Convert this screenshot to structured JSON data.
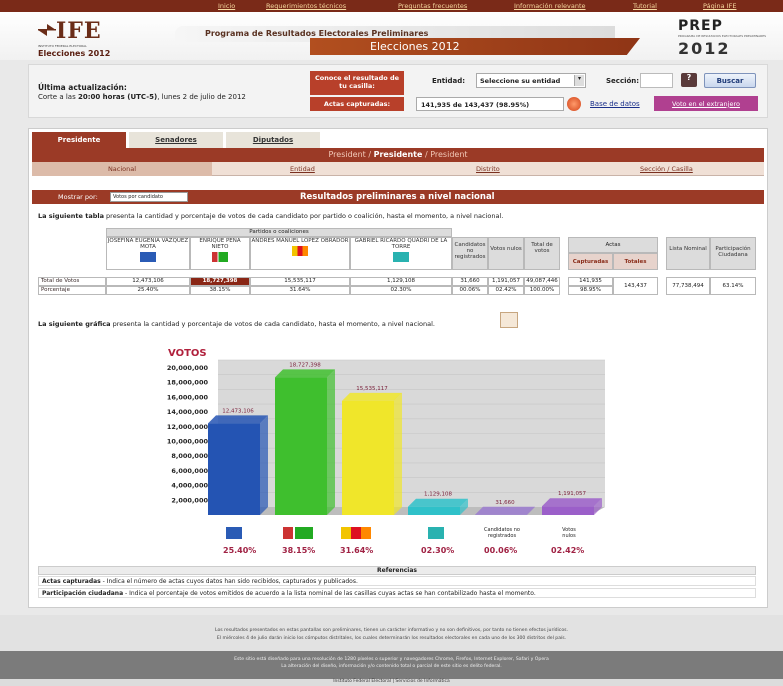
{
  "topnav": {
    "items": [
      "Inicio",
      "Requerimientos técnicos",
      "Preguntas frecuentes",
      "Información relevante",
      "Tutorial",
      "Página IFE"
    ]
  },
  "header": {
    "logo_text": "IFE",
    "logo_sub": "INSTITUTO FEDERAL ELECTORAL",
    "logo_elecciones": "Elecciones 2012",
    "program_title": "Programa de Resultados Electorales Preliminares",
    "elecciones_bar": "Elecciones 2012",
    "prep_title": "PREP",
    "prep_sub": "PROGRAMA DE RESULTADOS ELECTORALES PRELIMINARES",
    "prep_year": "2012"
  },
  "update": {
    "label": "Última actualización:",
    "text_prefix": "Corte a las ",
    "text_bold": "20:00 horas (UTC-5)",
    "text_suffix": ", lunes 2 de julio de 2012",
    "conoce": "Conoce el resultado de tu casilla:",
    "entidad_label": "Entidad:",
    "entidad_value": "Seleccione su entidad",
    "seccion_label": "Sección:",
    "help": "?",
    "buscar": "Buscar",
    "actas_label": "Actas capturadas:",
    "actas_value": "141,935 de 143,437 (98.95%)",
    "base_link": "Base de datos",
    "voto_ext": "Voto en el extranjero"
  },
  "tabs": [
    "Presidente",
    "Senadores",
    "Diputados"
  ],
  "breadcrumb": {
    "left": "President / ",
    "bold": "Presidente",
    "right": " / President"
  },
  "levels": [
    "Nacional",
    "Entidad",
    "Distrito",
    "Sección / Casilla"
  ],
  "mostrar": {
    "label": "Mostrar por:",
    "value": "Votos por candidato",
    "title": "Resultados preliminares a nivel nacional"
  },
  "intro_table": {
    "bold": "La siguiente tabla",
    "text": " presenta la cantidad y porcentaje de votos de cada candidato por partido o coalición, hasta el momento, a nivel nacional."
  },
  "table": {
    "group_header": "Partidos o coaliciones",
    "candidates": [
      {
        "name": "JOSEFINA EUGENIA VAZQUEZ MOTA",
        "total": "12,473,106",
        "pct": "25.40%",
        "color": "#2a5bb5"
      },
      {
        "name": "ENRIQUE PEÑA NIETO",
        "total": "18,727,398",
        "pct": "38.15%",
        "color": "#2aa040"
      },
      {
        "name": "ANDRES MANUEL LOPEZ OBRADOR",
        "total": "15,535,117",
        "pct": "31.64%",
        "color": "#f2c400"
      },
      {
        "name": "GABRIEL RICARDO QUADRI DE LA TORRE",
        "total": "1,129,108",
        "pct": "02.30%",
        "color": "#29b2b0"
      }
    ],
    "extra_headers": [
      "Candidatos no registrados",
      "Votos nulos",
      "Total de votos"
    ],
    "extra_totals": [
      "31,660",
      "1,191,057",
      "49,087,446"
    ],
    "extra_pcts": [
      "00.06%",
      "02.42%",
      "100.00%"
    ],
    "actas_header": "Actas",
    "capturadas_header": "Capturadas",
    "totales_header": "Totales",
    "capturadas_value": "141,935",
    "capturadas_pct": "98.95%",
    "totales_value": "143,437",
    "lista_header": "Lista Nominal",
    "lista_value": "77,738,494",
    "participacion_header": "Participación Ciudadana",
    "participacion_value": "63.14%",
    "row_total": "Total de Votos",
    "row_pct": "Porcentaje"
  },
  "intro_chart": {
    "bold": "La siguiente gráfica",
    "text": " presenta la cantidad y porcentaje de votos de cada candidato, hasta el momento, a nivel nacional."
  },
  "chart_data": {
    "type": "bar",
    "title": "VOTOS",
    "categories": [
      "PAN",
      "PRI-PVEM",
      "PRD-PT-MC",
      "NUEVA ALIANZA",
      "Candidatos no registrados",
      "Votos nulos"
    ],
    "values": [
      12473106,
      18727398,
      15535117,
      1129108,
      31660,
      1191057
    ],
    "value_labels": [
      "12,473,106",
      "18,727,398",
      "15,535,117",
      "1,129,108",
      "31,660",
      "1,191,057"
    ],
    "colors": [
      "#2454b3",
      "#3fbf2e",
      "#f0e62a",
      "#2fc1c9",
      "#9b7bd0",
      "#9b5fc9"
    ],
    "pct_labels": [
      "25.40%",
      "38.15%",
      "31.64%",
      "02.30%",
      "00.06%",
      "02.42%"
    ],
    "ylim": [
      0,
      20000000
    ],
    "yticks": [
      "20,000,000",
      "18,000,000",
      "16,000,000",
      "14,000,000",
      "12,000,000",
      "10,000,000",
      "8,000,000",
      "6,000,000",
      "4,000,000",
      "2,000,000"
    ],
    "cat_text": [
      "",
      "",
      "",
      "",
      "Candidatos no registrados",
      "Votos nulos"
    ]
  },
  "references": {
    "title": "Referencias",
    "r1_bold": "Actas capturadas",
    "r1_text": " - Indica el número de actas cuyos datos han sido recibidos, capturados y publicados.",
    "r2_bold": "Participación ciudadana",
    "r2_text": " - Indica el porcentaje de votos emitidos de acuerdo a la lista nominal de las casillas cuyas actas se han contabilizado hasta el momento."
  },
  "footer": {
    "l1": "Los resultados presentados en estas pantallas son preliminares, tienen un carácter informativo y no son definitivos, por tanto no tienen efectos jurídicos.",
    "l2": "El miércoles 4 de julio darán inicio los cómputos distritales, los cuales determinarán los resultados electorales en cada uno de los 300 distritos del país.",
    "l3": "Este sitio está diseñado para una resolución de 1280 píxeles o superior y navegadores Chrome, Firefox, Internet Explorer, Safari y Opera",
    "l4": "La alteración del diseño, información y/o contenido total o parcial de este sitio es delito federal.",
    "l5": "Instituto Federal Electoral | Servicios de Informática"
  }
}
